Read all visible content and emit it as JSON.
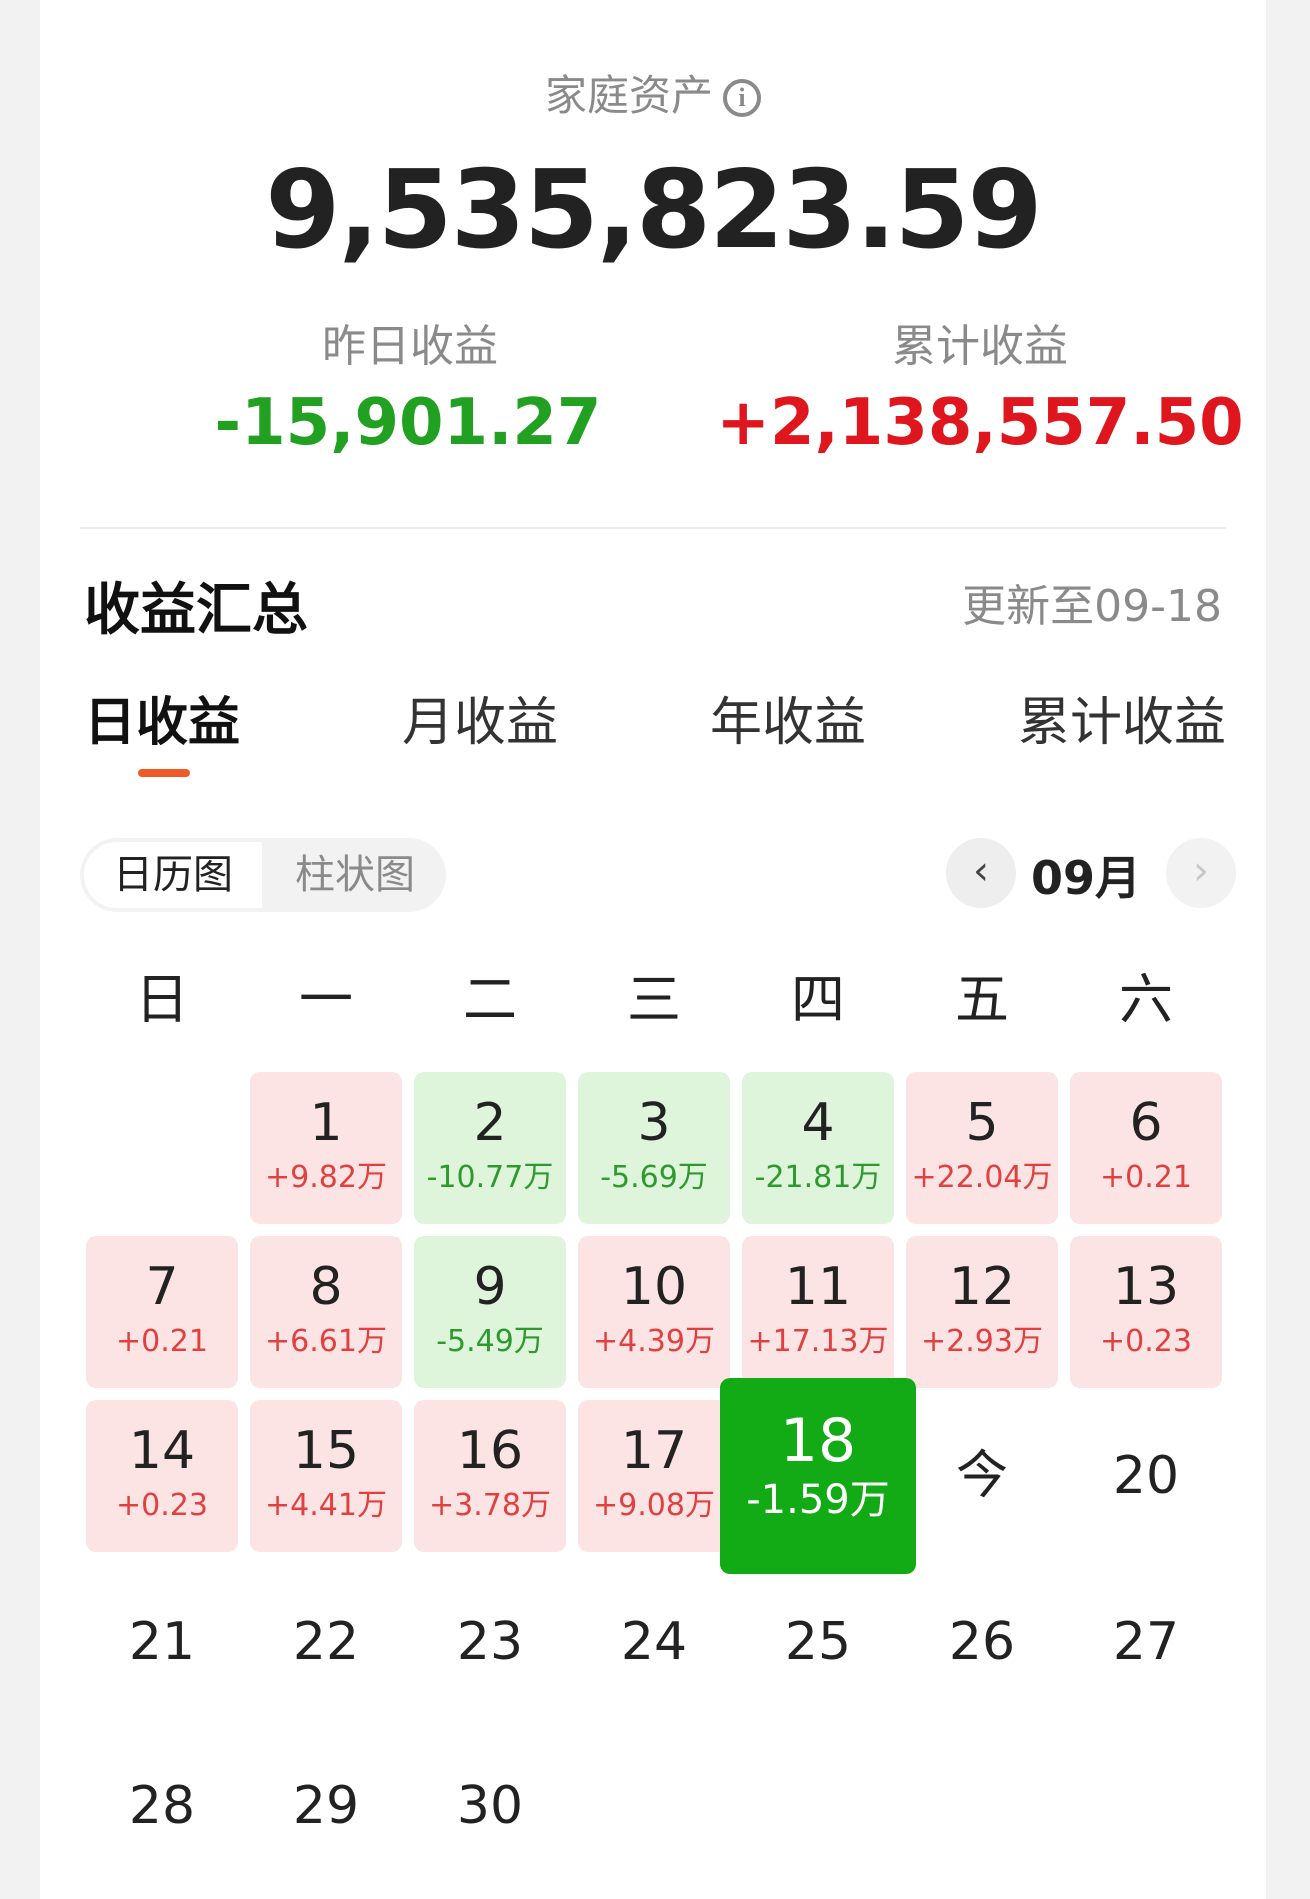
{
  "header": {
    "asset_label": "家庭资产",
    "info_icon": "info-icon",
    "asset_value": "9,535,823.59",
    "yesterday_label": "昨日收益",
    "yesterday_value": "-15,901.27",
    "total_label": "累计收益",
    "total_value": "+2,138,557.50"
  },
  "section": {
    "title": "收益汇总",
    "updated": "更新至09-18"
  },
  "tabs": [
    {
      "label": "日收益",
      "active": true
    },
    {
      "label": "月收益",
      "active": false
    },
    {
      "label": "年收益",
      "active": false
    },
    {
      "label": "累计收益",
      "active": false
    }
  ],
  "view_toggle": {
    "calendar": "日历图",
    "bar": "柱状图",
    "selected": "日历图"
  },
  "month_nav": {
    "prev_icon": "chevron-left-icon",
    "month": "09月",
    "next_icon": "chevron-right-icon"
  },
  "weekdays": [
    "日",
    "一",
    "二",
    "三",
    "四",
    "五",
    "六"
  ],
  "colors": {
    "gain": "#e04040",
    "loss": "#2e9a2e",
    "selected": "#12aa15",
    "accent": "#ef5a28"
  },
  "days": [
    {
      "d": "1",
      "v": "+9.82万",
      "t": "up"
    },
    {
      "d": "2",
      "v": "-10.77万",
      "t": "down"
    },
    {
      "d": "3",
      "v": "-5.69万",
      "t": "down"
    },
    {
      "d": "4",
      "v": "-21.81万",
      "t": "down"
    },
    {
      "d": "5",
      "v": "+22.04万",
      "t": "up"
    },
    {
      "d": "6",
      "v": "+0.21",
      "t": "up"
    },
    {
      "d": "7",
      "v": "+0.21",
      "t": "up"
    },
    {
      "d": "8",
      "v": "+6.61万",
      "t": "up"
    },
    {
      "d": "9",
      "v": "-5.49万",
      "t": "down"
    },
    {
      "d": "10",
      "v": "+4.39万",
      "t": "up"
    },
    {
      "d": "11",
      "v": "+17.13万",
      "t": "up"
    },
    {
      "d": "12",
      "v": "+2.93万",
      "t": "up"
    },
    {
      "d": "13",
      "v": "+0.23",
      "t": "up"
    },
    {
      "d": "14",
      "v": "+0.23",
      "t": "up"
    },
    {
      "d": "15",
      "v": "+4.41万",
      "t": "up"
    },
    {
      "d": "16",
      "v": "+3.78万",
      "t": "up"
    },
    {
      "d": "17",
      "v": "+9.08万",
      "t": "up"
    },
    {
      "d": "18",
      "v": "-1.59万",
      "t": "sel"
    },
    {
      "d": "今",
      "v": "",
      "t": "plain"
    },
    {
      "d": "20",
      "v": "",
      "t": "plain"
    },
    {
      "d": "21",
      "v": "",
      "t": "plain"
    },
    {
      "d": "22",
      "v": "",
      "t": "plain"
    },
    {
      "d": "23",
      "v": "",
      "t": "plain"
    },
    {
      "d": "24",
      "v": "",
      "t": "plain"
    },
    {
      "d": "25",
      "v": "",
      "t": "plain"
    },
    {
      "d": "26",
      "v": "",
      "t": "plain"
    },
    {
      "d": "27",
      "v": "",
      "t": "plain"
    },
    {
      "d": "28",
      "v": "",
      "t": "plain"
    },
    {
      "d": "29",
      "v": "",
      "t": "plain"
    },
    {
      "d": "30",
      "v": "",
      "t": "plain"
    }
  ]
}
